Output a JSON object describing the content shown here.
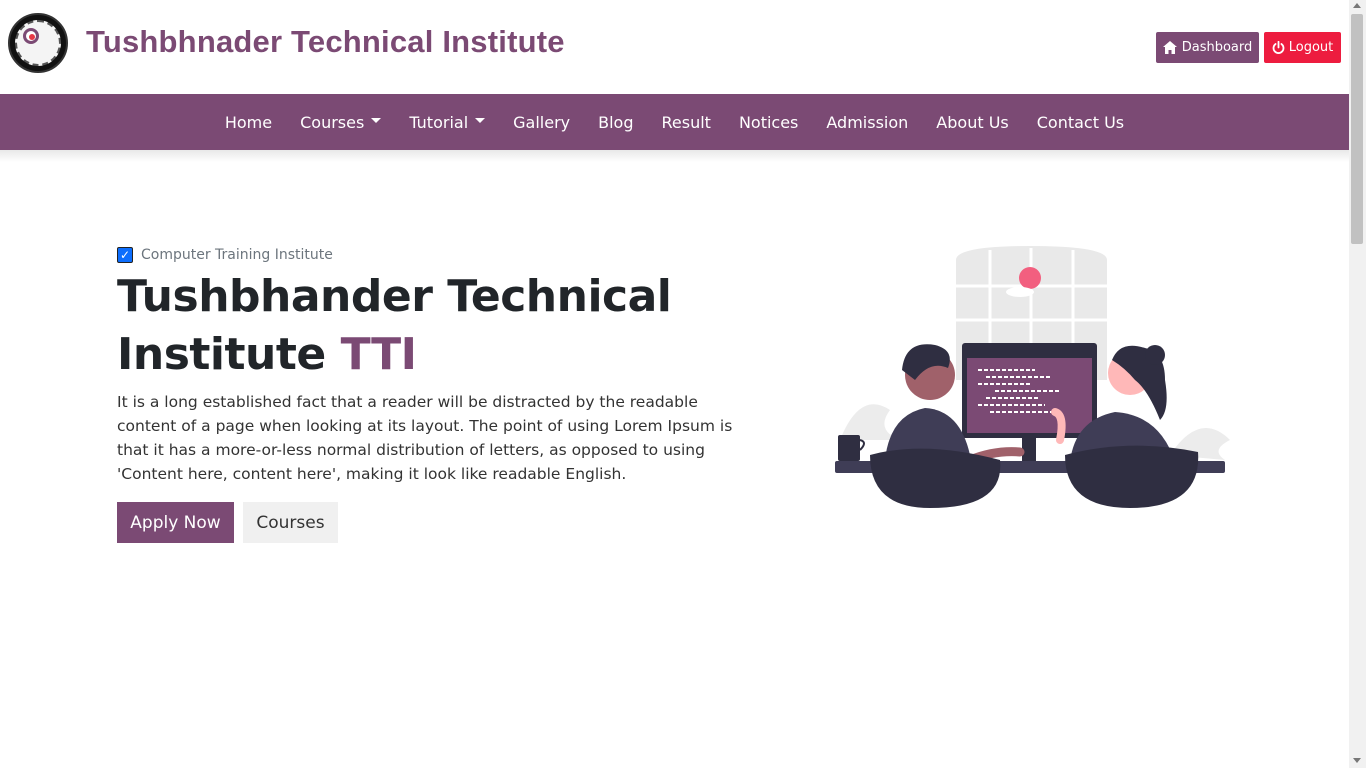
{
  "header": {
    "site_title": "Tushbhnader Technical Institute",
    "logo_icon": "institute-seal-logo",
    "dashboard_label": "Dashboard",
    "dashboard_icon": "home-icon",
    "logout_label": "Logout",
    "logout_icon": "power-icon"
  },
  "nav": {
    "items": [
      {
        "label": "Home"
      },
      {
        "label": "Courses",
        "dropdown": true
      },
      {
        "label": "Tutorial",
        "dropdown": true
      },
      {
        "label": "Gallery"
      },
      {
        "label": "Blog"
      },
      {
        "label": "Result"
      },
      {
        "label": "Notices"
      },
      {
        "label": "Admission"
      },
      {
        "label": "About Us"
      },
      {
        "label": "Contact Us"
      }
    ]
  },
  "hero": {
    "tagline": "Computer Training Institute",
    "title_main": "Tushbhander Technical Institute",
    "title_accent": "TTI",
    "description": "It is a long established fact that a reader will be distracted by the readable content of a page when looking at its layout. The point of using Lorem Ipsum is that it has a more-or-less normal distribution of letters, as opposed to using 'Content here, content here', making it look like readable English.",
    "apply_label": "Apply Now",
    "courses_label": "Courses",
    "illustration": "two-people-at-computer-illustration"
  },
  "colors": {
    "brand": "#7b4a74",
    "logout": "#ed1c3f",
    "secondary_button": "#f0f0f0"
  }
}
